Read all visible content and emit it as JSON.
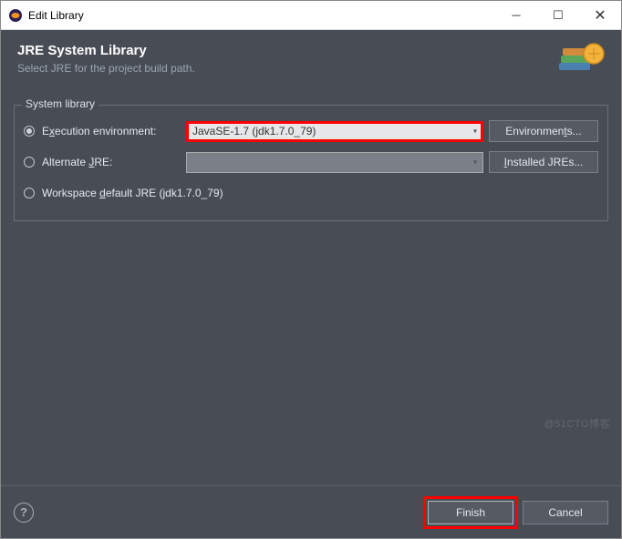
{
  "window": {
    "title": "Edit Library"
  },
  "header": {
    "title": "JRE System Library",
    "subtitle": "Select JRE for the project build path."
  },
  "fieldset": {
    "legend": "System library",
    "exec_env": {
      "label_pre": "E",
      "label_u": "x",
      "label_post": "ecution environment:",
      "selected": "JavaSE-1.7 (jdk1.7.0_79)",
      "button_pre": "Environmen",
      "button_u": "t",
      "button_post": "s..."
    },
    "alt_jre": {
      "label_pre": "Alternate ",
      "label_u": "J",
      "label_post": "RE:",
      "selected": "",
      "button_u": "I",
      "button_post": "nstalled JREs..."
    },
    "workspace": {
      "label_pre": "Workspace ",
      "label_u": "d",
      "label_post": "efault JRE (jdk1.7.0_79)"
    }
  },
  "footer": {
    "finish_u": "F",
    "finish_post": "inish",
    "cancel": "Cancel"
  },
  "watermark": "@51CTO博客"
}
